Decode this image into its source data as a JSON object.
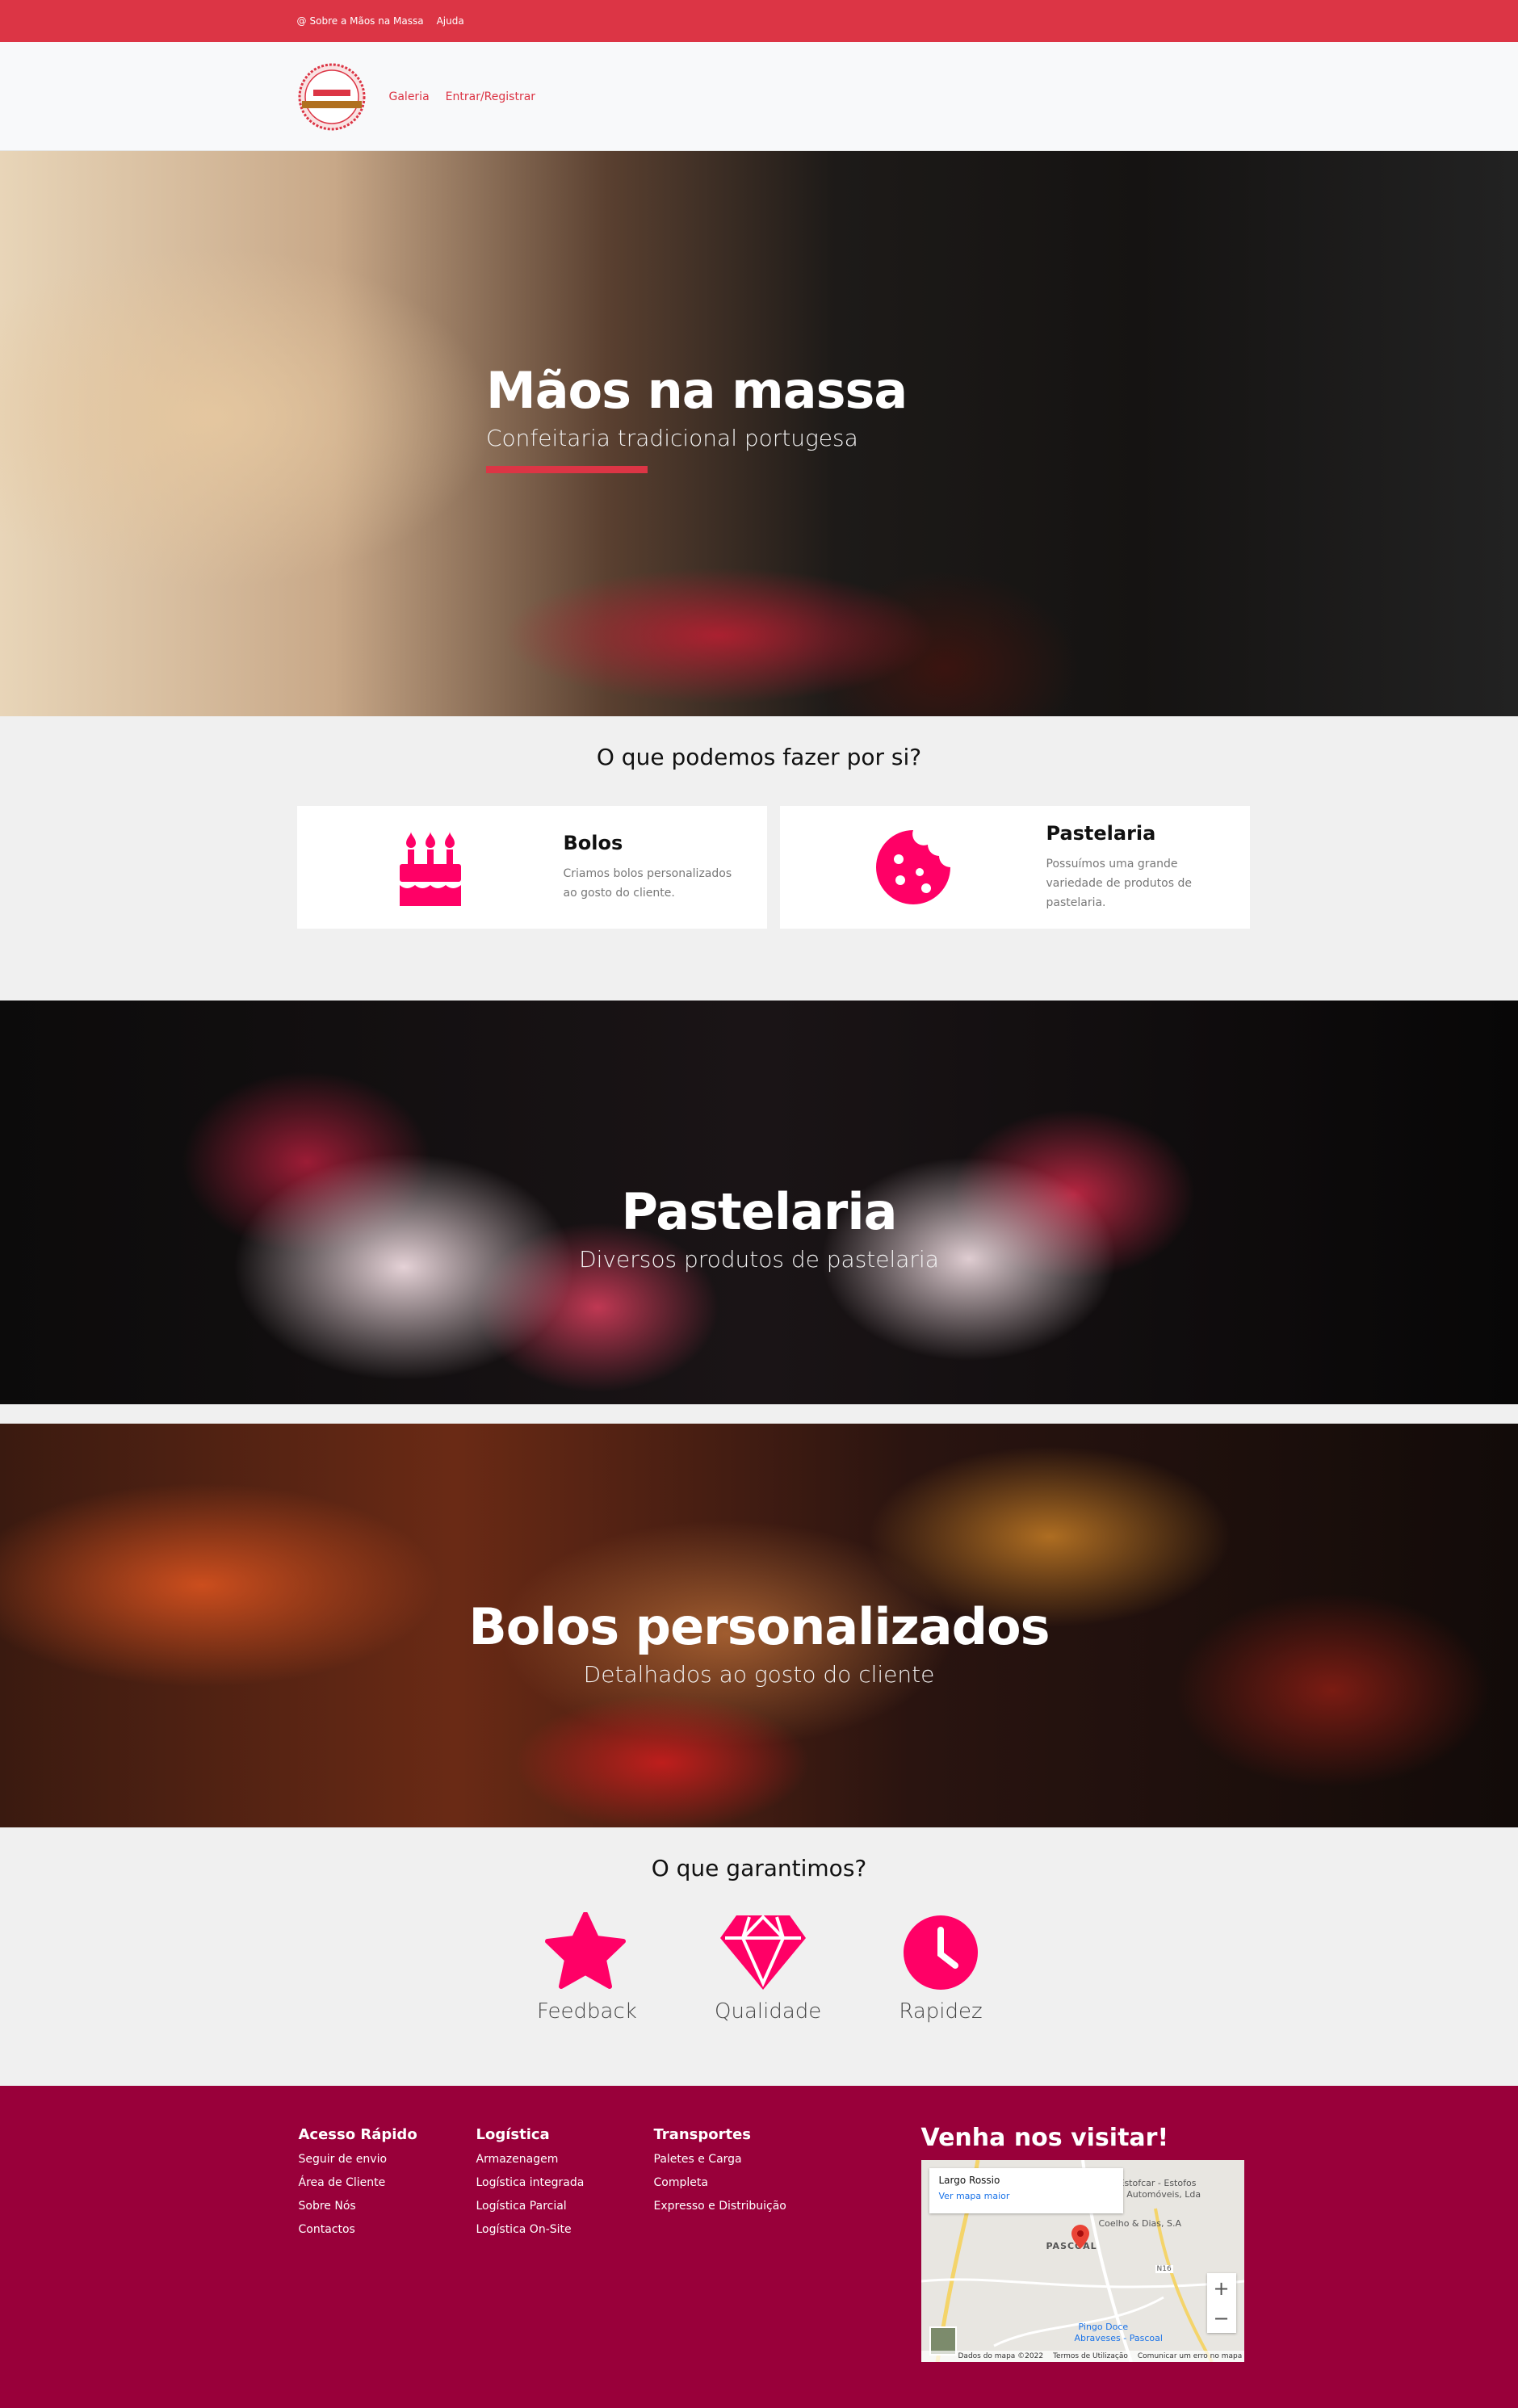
{
  "topbar": {
    "about_icon": "at-icon",
    "about_label": "Sobre a Mãos na Massa",
    "help_label": "Ajuda"
  },
  "nav": {
    "logo_text_top": "MÃOS NA MASSA",
    "logo_text_bottom": "CONFEITARIA TRADICIONAL",
    "links": [
      "Galeria",
      "Entrar/Registrar"
    ]
  },
  "hero": {
    "title": "Mãos na massa",
    "subtitle": "Confeitaria tradicional portugesa"
  },
  "services": {
    "title": "O que podemos fazer por si?",
    "cards": [
      {
        "title": "Bolos",
        "text": "Criamos bolos personalizados ao gosto do cliente.",
        "icon": "birthday-cake-icon"
      },
      {
        "title": "Pastelaria",
        "text": "Possuímos uma grande variedade de produtos de pastelaria.",
        "icon": "cookie-icon"
      }
    ]
  },
  "banner_pastelaria": {
    "title": "Pastelaria",
    "subtitle": "Diversos produtos de pastelaria"
  },
  "banner_bolos": {
    "title": "Bolos personalizados",
    "subtitle": "Detalhados ao gosto do cliente"
  },
  "guarantees": {
    "title": "O que garantimos?",
    "items": [
      {
        "label": "Feedback",
        "icon": "star-icon"
      },
      {
        "label": "Qualidade",
        "icon": "gem-icon"
      },
      {
        "label": "Rapidez",
        "icon": "clock-icon"
      }
    ]
  },
  "footer": {
    "columns": [
      {
        "title": "Acesso Rápido",
        "links": [
          "Seguir de envio",
          "Área de Cliente",
          "Sobre Nós",
          "Contactos"
        ]
      },
      {
        "title": "Logística",
        "links": [
          "Armazenagem",
          "Logística integrada",
          "Logística Parcial",
          "Logística On-Site"
        ]
      },
      {
        "title": "Transportes",
        "links": [
          "Paletes e Carga",
          "Completa",
          "Expresso e Distribuição"
        ]
      }
    ],
    "visit_title": "Venha nos visitar!",
    "map": {
      "place": "Largo Rossio",
      "view_larger": "Ver mapa maior",
      "labels": [
        "PASCOAL",
        "Coelho & Dias, S.A",
        "Estofcar - Estofos",
        "ra Automóveis, Lda",
        "Pingo Doce",
        "Abraveses - Pascoal",
        "N16"
      ],
      "footer_items": [
        "Dados do mapa ©2022",
        "Termos de Utilização",
        "Comunicar um erro no mapa"
      ],
      "zoom_in": "+",
      "zoom_out": "−"
    }
  },
  "colors": {
    "primary_red": "#dc3545",
    "accent_pink": "#ff0066",
    "footer_bg": "#99003a",
    "page_bg": "#f0f0f0"
  }
}
